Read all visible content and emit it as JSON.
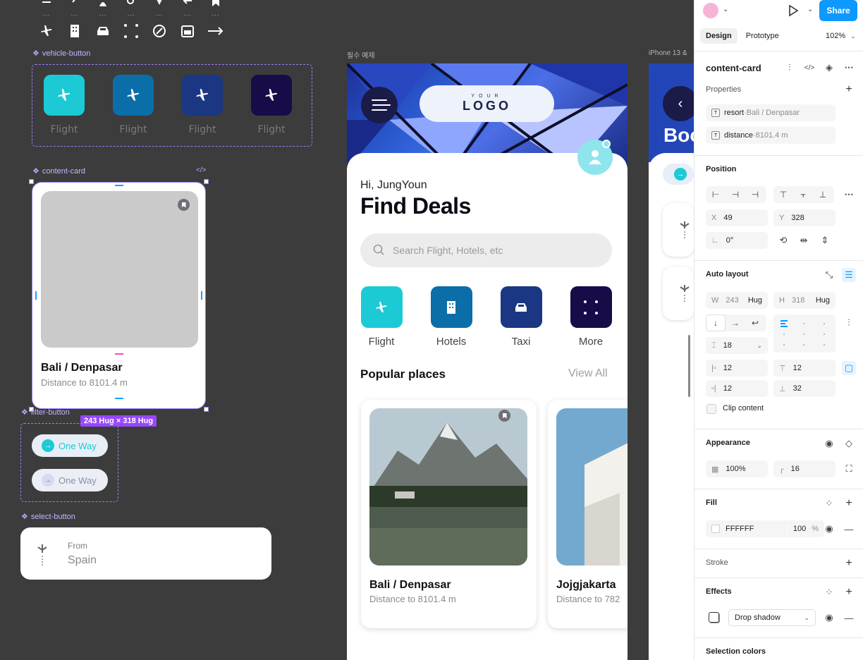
{
  "canvas": {
    "component_labels": {
      "vehicle_button": "vehicle-button",
      "content_card": "content-card",
      "filter_button": "filter-button",
      "select_button": "select-button"
    },
    "frame_labels": {
      "middle": "필수 예제",
      "right": "iPhone 13 &"
    },
    "vehicle_buttons": [
      {
        "label": "Flight",
        "color": "#1ccad6"
      },
      {
        "label": "Flight",
        "color": "#0b6ea8"
      },
      {
        "label": "Flight",
        "color": "#1b3784"
      },
      {
        "label": "Flight",
        "color": "#170b48"
      }
    ],
    "content_card": {
      "title": "Bali / Denpasar",
      "subtitle": "Distance to 8101.4 m",
      "size_badge": "243 Hug × 318 Hug"
    },
    "filter_buttons": [
      {
        "label": "One Way",
        "state": "active",
        "accent": "#1ccad6"
      },
      {
        "label": "One Way",
        "state": "inactive",
        "accent": "#b9b9e6"
      }
    ],
    "select_button": {
      "from_label": "From",
      "value": "Spain"
    }
  },
  "app": {
    "logo_top": "YOUR",
    "logo_main": "LOGO",
    "greeting": "Hi, JungYoun",
    "headline": "Find Deals",
    "search_placeholder": "Search Flight, Hotels, etc",
    "categories": [
      {
        "label": "Flight",
        "color": "#1ccad6"
      },
      {
        "label": "Hotels",
        "color": "#0b6ea8"
      },
      {
        "label": "Taxi",
        "color": "#1b3784"
      },
      {
        "label": "More",
        "color": "#170b48"
      }
    ],
    "section_title": "Popular places",
    "view_all": "View All",
    "places": [
      {
        "title": "Bali / Denpasar",
        "subtitle": "Distance to 8101.4 m"
      },
      {
        "title": "Jojgjakarta",
        "subtitle": "Distance to 782"
      }
    ],
    "right_frame_heading": "Boo"
  },
  "panel": {
    "share_label": "Share",
    "tabs": [
      "Design",
      "Prototype"
    ],
    "zoom": "102%",
    "layer_name": "content-card",
    "properties_title": "Properties",
    "properties": [
      {
        "name": "resort",
        "value": "Bali / Denpasar"
      },
      {
        "name": "distance",
        "value": "8101.4 m"
      }
    ],
    "position_title": "Position",
    "x_label": "X",
    "x_value": "49",
    "y_label": "Y",
    "y_value": "328",
    "rotation": "0°",
    "auto_layout_title": "Auto layout",
    "w_label": "W",
    "w_value": "243",
    "w_mode": "Hug",
    "h_label": "H",
    "h_value": "318",
    "h_mode": "Hug",
    "gap": "18",
    "pad_left": "12",
    "pad_top": "12",
    "pad_right": "12",
    "pad_bottom": "32",
    "clip_content": "Clip content",
    "appearance_title": "Appearance",
    "opacity": "100%",
    "radius": "16",
    "fill_title": "Fill",
    "fill_hex": "FFFFFF",
    "fill_opacity": "100",
    "fill_unit": "%",
    "stroke_title": "Stroke",
    "effects_title": "Effects",
    "effect_type": "Drop shadow",
    "selection_colors_title": "Selection colors"
  }
}
